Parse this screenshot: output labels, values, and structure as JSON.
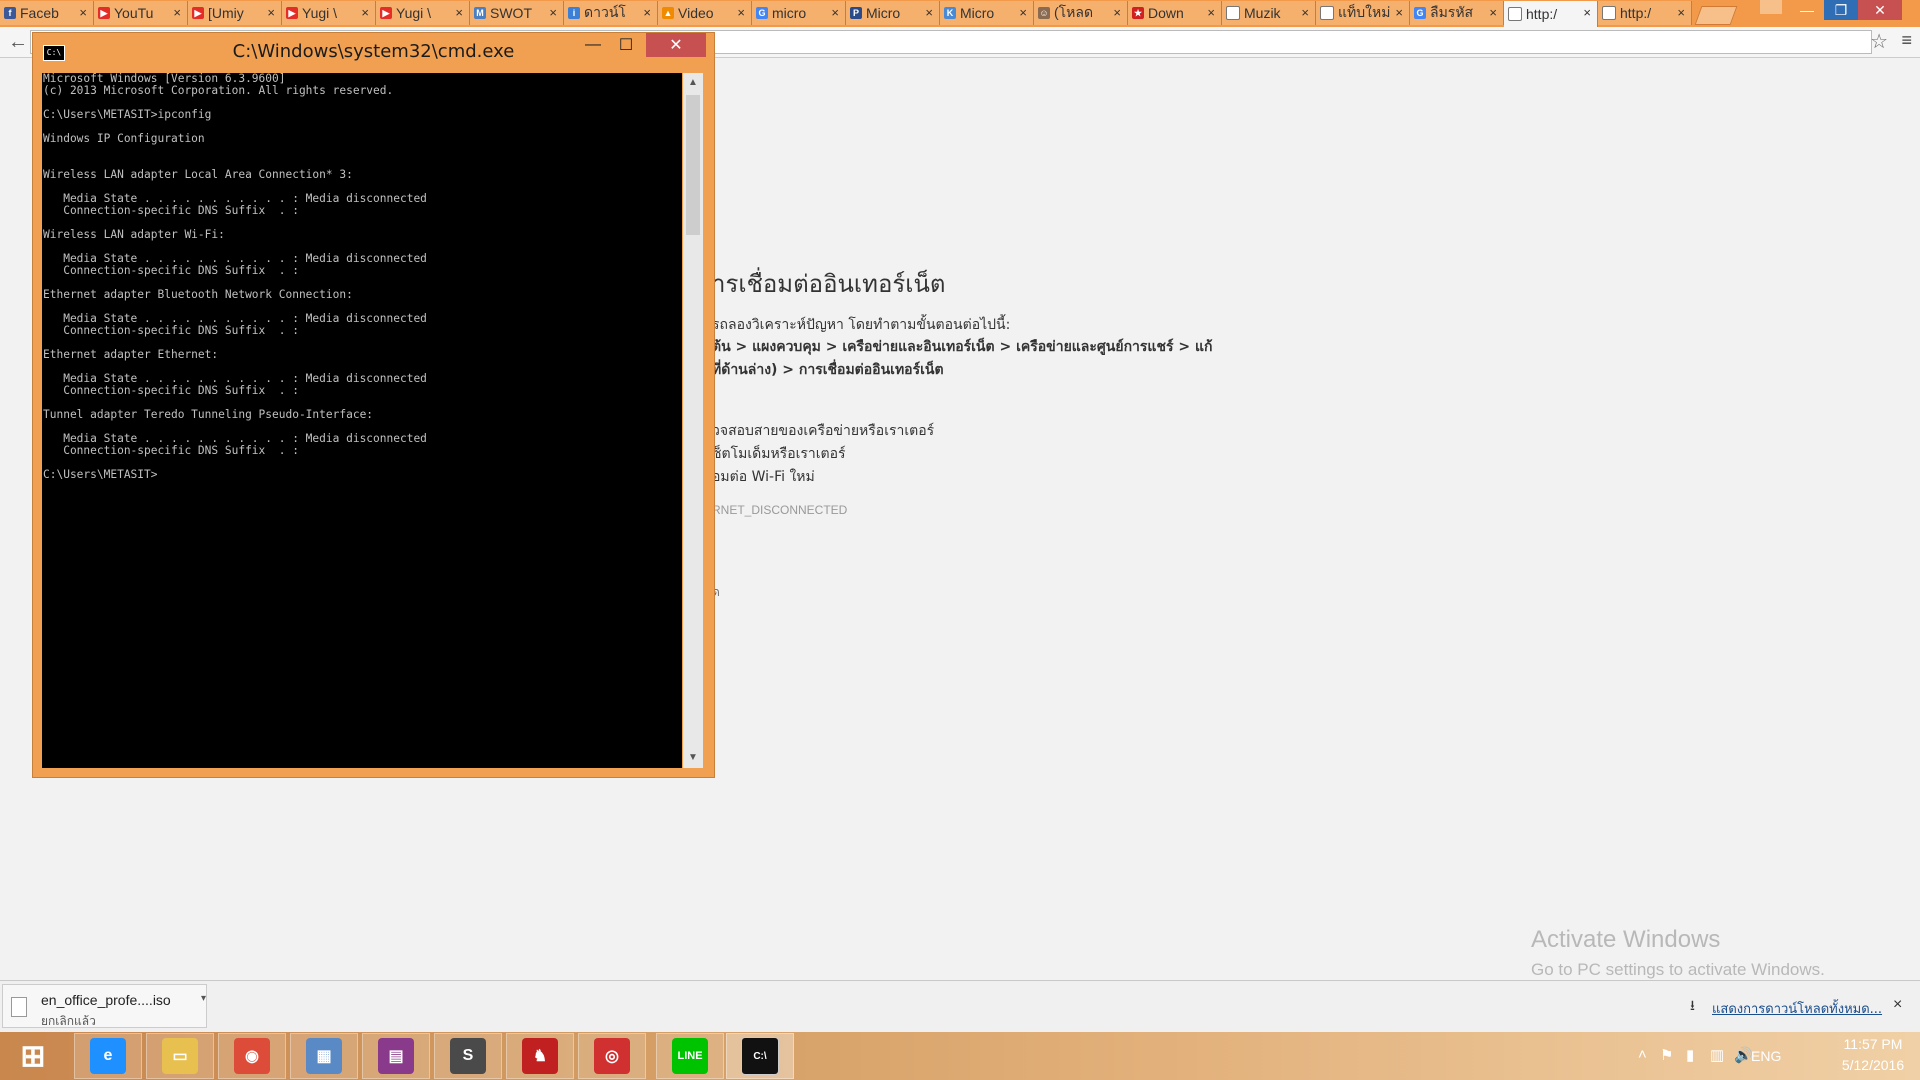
{
  "browser": {
    "tabs": [
      {
        "title": "Faceb",
        "icon": "facebook-icon",
        "color": "#3b5998",
        "glyph": "f"
      },
      {
        "title": "YouTu",
        "icon": "youtube-icon",
        "color": "#e52d27",
        "glyph": "▶"
      },
      {
        "title": "[Umiy",
        "icon": "youtube-icon",
        "color": "#e52d27",
        "glyph": "▶"
      },
      {
        "title": "Yugi \\",
        "icon": "youtube-icon",
        "color": "#e52d27",
        "glyph": "▶"
      },
      {
        "title": "Yugi \\",
        "icon": "youtube-icon",
        "color": "#e52d27",
        "glyph": "▶"
      },
      {
        "title": "SWOT",
        "icon": "doc-m-icon",
        "color": "#4a7fc1",
        "glyph": "M"
      },
      {
        "title": "ดาวน์โ",
        "icon": "info-icon",
        "color": "#3b7fd6",
        "glyph": "i"
      },
      {
        "title": "Video",
        "icon": "vlc-icon",
        "color": "#f08a00",
        "glyph": "▲"
      },
      {
        "title": "micro",
        "icon": "google-icon",
        "color": "#4285f4",
        "glyph": "G"
      },
      {
        "title": "Micro",
        "icon": "site-icon",
        "color": "#2a4a8a",
        "glyph": "P"
      },
      {
        "title": "Micro",
        "icon": "site-icon",
        "color": "#4a8ad4",
        "glyph": "K"
      },
      {
        "title": "(โหลด",
        "icon": "avatar-icon",
        "color": "#8a6a50",
        "glyph": "☺"
      },
      {
        "title": "Down",
        "icon": "star-site-icon",
        "color": "#d02020",
        "glyph": "★"
      },
      {
        "title": "Muzik",
        "icon": "page-icon",
        "color": "#ffffff",
        "glyph": ""
      },
      {
        "title": "แท็บใหม่",
        "icon": "page-icon",
        "color": "#ffffff",
        "glyph": ""
      },
      {
        "title": "ลืมรหัส",
        "icon": "google-icon",
        "color": "#4285f4",
        "glyph": "G"
      },
      {
        "title": "http:/",
        "icon": "page-icon",
        "color": "#ffffff",
        "glyph": "",
        "active": true
      },
      {
        "title": "http:/",
        "icon": "page-icon",
        "color": "#ffffff",
        "glyph": ""
      }
    ],
    "tab_close": "×",
    "window_minimize": "—",
    "window_maximize": "❐",
    "window_close": "✕",
    "back": "←",
    "star": "☆",
    "menu": "≡",
    "accent_color": "#f29a4a"
  },
  "error_page": {
    "heading": "ารเชื่อมต่ออินเทอร์เน็ต",
    "intro": "รถลองวิเคราะห์ปัญหา โดยทำตามขั้นตอนต่อไปนี้:",
    "steps_line1": "ต้น > แผงควบคุม > เครือข่ายและอินเทอร์เน็ต > เครือข่ายและศูนย์การแชร์ > แก้",
    "steps_line2": "ที่ด้านล่าง) > การเชื่อมต่ออินเทอร์เน็ต",
    "suggestions": [
      "วจสอบสายของเครือข่ายหรือเราเตอร์",
      "ซ็ตโมเด็มหรือเราเตอร์",
      "อมต่อ Wi-Fi ใหม่"
    ],
    "error_code": "RNET_DISCONNECTED",
    "more": "ด"
  },
  "watermark": {
    "title": "Activate Windows",
    "subtitle": "Go to PC settings to activate Windows."
  },
  "downloads": {
    "file_name": "en_office_profe....iso",
    "status": "ยกเลิกแล้ว",
    "dropdown": "▾",
    "show_all": "แสดงการดาวน์โหลดทั้งหมด...",
    "download_icon": "⭳",
    "close": "×"
  },
  "cmd": {
    "title": "C:\\Windows\\system32\\cmd.exe",
    "icon_label": "C:\\",
    "minimize": "—",
    "maximize": "☐",
    "close": "✕",
    "scroll_up": "▲",
    "scroll_down": "▼",
    "lines": [
      "Microsoft Windows [Version 6.3.9600]",
      "(c) 2013 Microsoft Corporation. All rights reserved.",
      "",
      "C:\\Users\\METASIT>ipconfig",
      "",
      "Windows IP Configuration",
      "",
      "",
      "Wireless LAN adapter Local Area Connection* 3:",
      "",
      "   Media State . . . . . . . . . . . : Media disconnected",
      "   Connection-specific DNS Suffix  . :",
      "",
      "Wireless LAN adapter Wi-Fi:",
      "",
      "   Media State . . . . . . . . . . . : Media disconnected",
      "   Connection-specific DNS Suffix  . :",
      "",
      "Ethernet adapter Bluetooth Network Connection:",
      "",
      "   Media State . . . . . . . . . . . : Media disconnected",
      "   Connection-specific DNS Suffix  . :",
      "",
      "Ethernet adapter Ethernet:",
      "",
      "   Media State . . . . . . . . . . . : Media disconnected",
      "   Connection-specific DNS Suffix  . :",
      "",
      "Tunnel adapter Teredo Tunneling Pseudo-Interface:",
      "",
      "   Media State . . . . . . . . . . . : Media disconnected",
      "   Connection-specific DNS Suffix  . :",
      "",
      "C:\\Users\\METASIT>"
    ]
  },
  "taskbar": {
    "apps": [
      {
        "name": "start-button",
        "glyph": "⊞",
        "color": "#ffffff"
      },
      {
        "name": "internet-explorer-icon",
        "glyph": "e",
        "color": "#1e90ff"
      },
      {
        "name": "file-explorer-icon",
        "glyph": "▭",
        "color": "#e8c050"
      },
      {
        "name": "chrome-icon",
        "glyph": "◉",
        "color": "#dd4b39"
      },
      {
        "name": "remote-desktop-icon",
        "glyph": "▦",
        "color": "#5a8ac6"
      },
      {
        "name": "winrar-icon",
        "glyph": "▤",
        "color": "#8a3a8a"
      },
      {
        "name": "sublime-text-icon",
        "glyph": "S",
        "color": "#4a4a4a"
      },
      {
        "name": "game-app-icon",
        "glyph": "♞",
        "color": "#c02020"
      },
      {
        "name": "garena-icon",
        "glyph": "◎",
        "color": "#d03030"
      },
      {
        "name": "line-app-icon",
        "glyph": "LINE",
        "color": "#00c300"
      },
      {
        "name": "cmd-taskbar-icon",
        "glyph": "C:\\",
        "color": "#111111"
      }
    ],
    "tray_up": "˄",
    "tray_icons": [
      "⚑",
      "▮",
      "▥",
      "🔊"
    ],
    "language": "ENG",
    "time": "11:57 PM",
    "date": "5/12/2016"
  }
}
